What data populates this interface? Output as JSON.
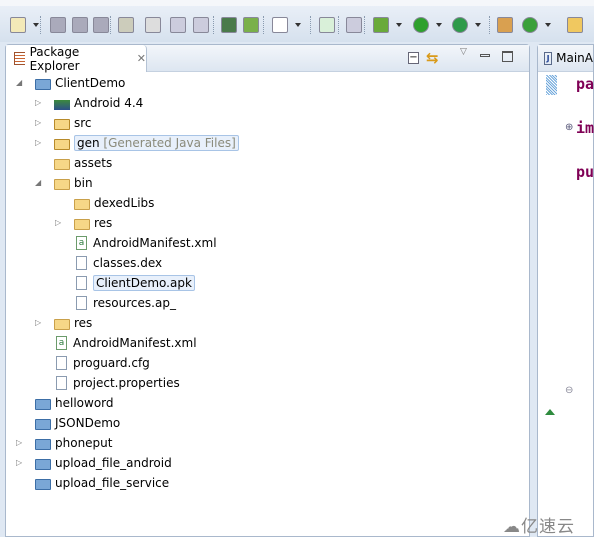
{
  "toolbar": {
    "icons": [
      "new-icon",
      "save-icon",
      "save-all-icon",
      "print-icon",
      "toggle-mark-icon",
      "pen-icon",
      "block-icon",
      "pilcrow-icon",
      "android-sdk-icon",
      "avd-manager-icon",
      "task-icon",
      "new-class-icon",
      "skip-breakpoints-icon",
      "debug-icon",
      "run-icon",
      "external-tools-icon",
      "new-package-icon",
      "refresh-icon",
      "open-folder-icon"
    ]
  },
  "explorer": {
    "tab_label": "Package Explorer",
    "tree": [
      {
        "level": 0,
        "toggle": "expanded",
        "icon": "project",
        "label": "ClientDemo"
      },
      {
        "level": 1,
        "toggle": "collapsed",
        "icon": "library",
        "label": "Android 4.4"
      },
      {
        "level": 1,
        "toggle": "collapsed",
        "icon": "package-folder",
        "label": "src"
      },
      {
        "level": 1,
        "toggle": "collapsed",
        "icon": "package-folder",
        "label": "gen",
        "decoration": "[Generated Java Files]",
        "framed": true
      },
      {
        "level": 1,
        "toggle": "none",
        "icon": "folder",
        "label": "assets"
      },
      {
        "level": 1,
        "toggle": "expanded",
        "icon": "folder",
        "label": "bin"
      },
      {
        "level": 2,
        "toggle": "none",
        "icon": "folder",
        "label": "dexedLibs"
      },
      {
        "level": 2,
        "toggle": "collapsed",
        "icon": "folder",
        "label": "res"
      },
      {
        "level": 2,
        "toggle": "none",
        "icon": "xml",
        "label": "AndroidManifest.xml"
      },
      {
        "level": 2,
        "toggle": "none",
        "icon": "file",
        "label": "classes.dex"
      },
      {
        "level": 2,
        "toggle": "none",
        "icon": "file",
        "label": "ClientDemo.apk",
        "selected": true
      },
      {
        "level": 2,
        "toggle": "none",
        "icon": "file",
        "label": "resources.ap_"
      },
      {
        "level": 1,
        "toggle": "collapsed",
        "icon": "folder",
        "label": "res"
      },
      {
        "level": 1,
        "toggle": "none",
        "icon": "xml",
        "label": "AndroidManifest.xml"
      },
      {
        "level": 1,
        "toggle": "none",
        "icon": "file",
        "label": "proguard.cfg"
      },
      {
        "level": 1,
        "toggle": "none",
        "icon": "file",
        "label": "project.properties"
      },
      {
        "level": 0,
        "toggle": "none",
        "icon": "closed-project",
        "label": "helloword"
      },
      {
        "level": 0,
        "toggle": "none",
        "icon": "closed-project",
        "label": "JSONDemo"
      },
      {
        "level": 0,
        "toggle": "collapsed",
        "icon": "project",
        "label": "phoneput"
      },
      {
        "level": 0,
        "toggle": "collapsed",
        "icon": "project",
        "label": "upload_file_android"
      },
      {
        "level": 0,
        "toggle": "none",
        "icon": "closed-project",
        "label": "upload_file_service"
      }
    ]
  },
  "editor": {
    "tab_label": "MainA",
    "code": [
      "pa",
      "im",
      "pu"
    ]
  },
  "watermark": "亿速云"
}
